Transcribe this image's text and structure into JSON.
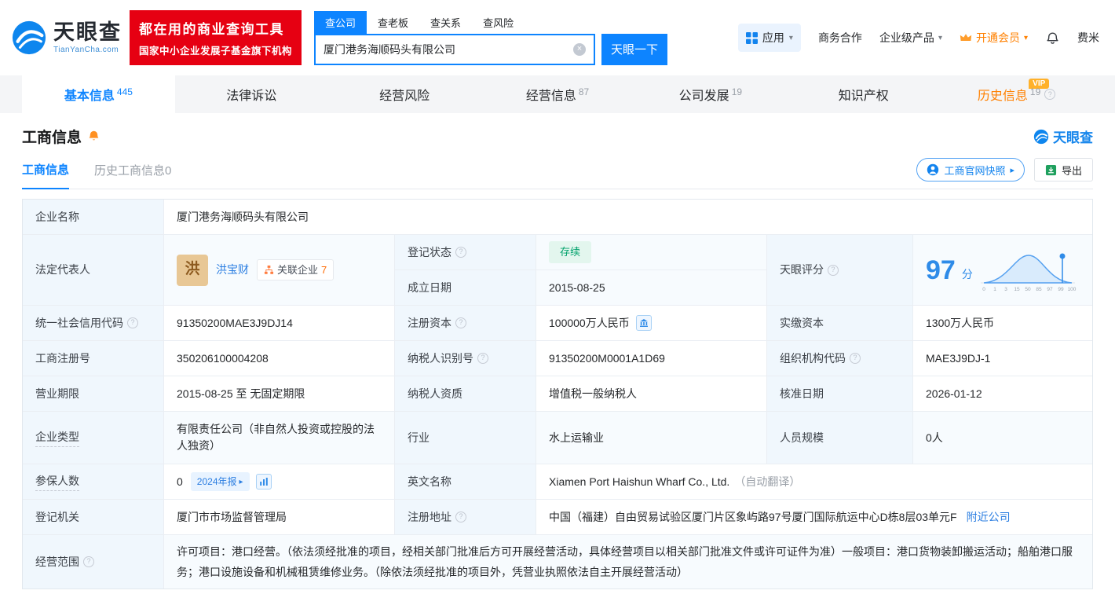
{
  "brand": {
    "name": "天眼查",
    "domain": "TianYanCha.com",
    "slogan_line1": "都在用的商业查询工具",
    "slogan_line2": "国家中小企业发展子基金旗下机构",
    "watermark": "天眼查"
  },
  "search": {
    "tabs": [
      "查公司",
      "查老板",
      "查关系",
      "查风险"
    ],
    "value": "厦门港务海顺码头有限公司",
    "button": "天眼一下"
  },
  "topmenu": {
    "apps": "应用",
    "cooperation": "商务合作",
    "enterprise": "企业级产品",
    "vip": "开通会员",
    "user": "费米"
  },
  "nav": {
    "tabs": [
      {
        "label": "基本信息",
        "count": "445"
      },
      {
        "label": "法律诉讼",
        "count": ""
      },
      {
        "label": "经营风险",
        "count": ""
      },
      {
        "label": "经营信息",
        "count": "87"
      },
      {
        "label": "公司发展",
        "count": "19"
      },
      {
        "label": "知识产权",
        "count": ""
      },
      {
        "label": "历史信息",
        "count": "19",
        "vip": "VIP"
      }
    ]
  },
  "section": {
    "title": "工商信息",
    "subtabs": [
      "工商信息",
      "历史工商信息0"
    ],
    "snapshot": "工商官网快照",
    "export": "导出"
  },
  "company": {
    "name_label": "企业名称",
    "name": "厦门港务海顺码头有限公司",
    "legal_label": "法定代表人",
    "legal_avatar": "洪",
    "legal_name": "洪宝财",
    "related_label": "关联企业",
    "related_count": "7",
    "status_label": "登记状态",
    "status": "存续",
    "establish_label": "成立日期",
    "establish": "2015-08-25",
    "score_label": "天眼评分",
    "score": "97",
    "score_unit": "分",
    "score_axis": [
      "0",
      "1",
      "3",
      "15",
      "50",
      "85",
      "97",
      "99",
      "100"
    ],
    "credit_label": "统一社会信用代码",
    "credit": "91350200MAE3J9DJ14",
    "regcap_label": "注册资本",
    "regcap": "100000万人民币",
    "paidcap_label": "实缴资本",
    "paidcap": "1300万人民币",
    "regno_label": "工商注册号",
    "regno": "350206100004208",
    "taxid_label": "纳税人识别号",
    "taxid": "91350200M0001A1D69",
    "orgcode_label": "组织机构代码",
    "orgcode": "MAE3J9DJ-1",
    "term_label": "营业期限",
    "term": "2015-08-25 至 无固定期限",
    "taxquality_label": "纳税人资质",
    "taxquality": "增值税一般纳税人",
    "approval_label": "核准日期",
    "approval": "2026-01-12",
    "type_label": "企业类型",
    "type": "有限责任公司（非自然人投资或控股的法人独资）",
    "industry_label": "行业",
    "industry": "水上运输业",
    "staff_label": "人员规模",
    "staff": "0人",
    "insured_label": "参保人数",
    "insured": "0",
    "annual_badge": "2024年报",
    "en_label": "英文名称",
    "en_name": "Xiamen Port Haishun Wharf Co., Ltd.",
    "en_note": "（自动翻译）",
    "authority_label": "登记机关",
    "authority": "厦门市市场监督管理局",
    "address_label": "注册地址",
    "address": "中国（福建）自由贸易试验区厦门片区象屿路97号厦门国际航运中心D栋8层03单元F",
    "nearby": "附近公司",
    "scope_label": "经营范围",
    "scope": "许可项目：港口经营。（依法须经批准的项目，经相关部门批准后方可开展经营活动，具体经营项目以相关部门批准文件或许可证件为准）一般项目：港口货物装卸搬运活动；船舶港口服务；港口设施设备和机械租赁维修业务。（除依法须经批准的项目外，凭营业执照依法自主开展经营活动）"
  }
}
